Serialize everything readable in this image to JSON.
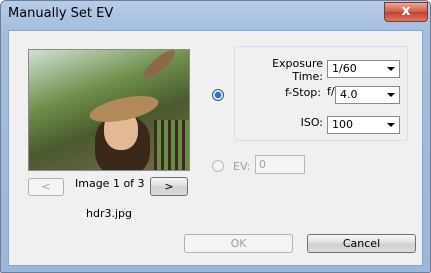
{
  "window": {
    "title": "Manually Set EV",
    "close_glyph": "x"
  },
  "preview": {
    "prev_label": "<",
    "next_label": ">",
    "counter": "Image 1 of 3",
    "filename": "hdr3.jpg"
  },
  "manual": {
    "exposure_label": "Exposure Time:",
    "exposure_value": "1/60",
    "fstop_label": "f-Stop:",
    "fstop_prefix": "f/",
    "fstop_value": "4.0",
    "iso_label": "ISO:",
    "iso_value": "100",
    "selected": true
  },
  "ev": {
    "label": "EV:",
    "value": "0",
    "selected": false
  },
  "buttons": {
    "ok": "OK",
    "cancel": "Cancel"
  }
}
